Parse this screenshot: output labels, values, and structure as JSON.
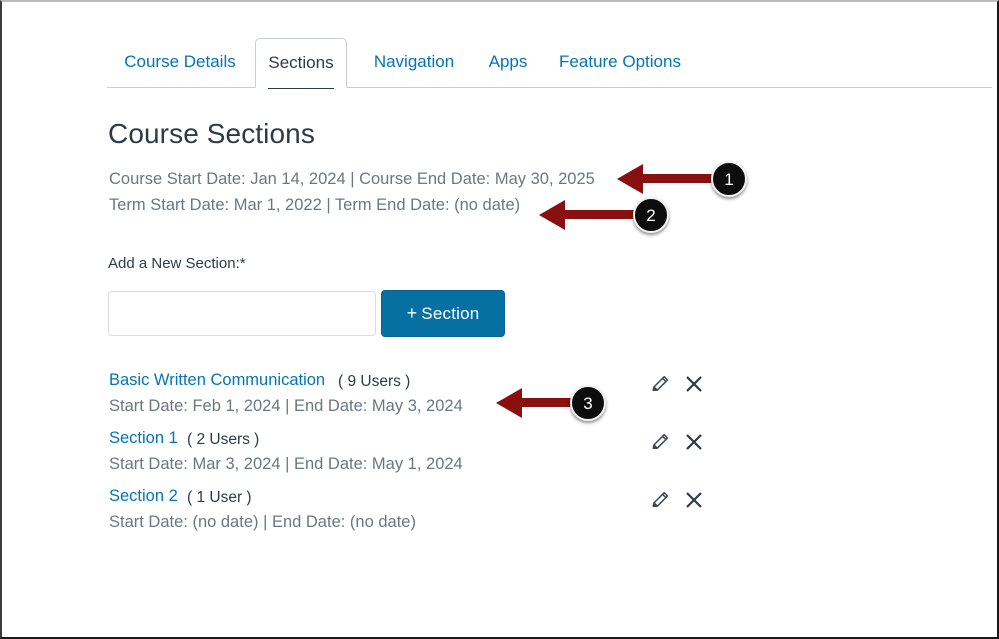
{
  "tabs": [
    {
      "label": "Course Details",
      "active": false
    },
    {
      "label": "Sections",
      "active": true
    },
    {
      "label": "Navigation",
      "active": false
    },
    {
      "label": "Apps",
      "active": false
    },
    {
      "label": "Feature Options",
      "active": false
    }
  ],
  "page": {
    "title": "Course Sections",
    "course_dates": "Course Start Date: Jan 14, 2024 | Course End Date: May 30, 2025",
    "term_dates": "Term Start Date: Mar 1, 2022 | Term End Date: (no date)"
  },
  "add_section": {
    "label": "Add a New Section:*",
    "input_value": "",
    "input_placeholder": "",
    "button_plus": "+",
    "button_label": "Section"
  },
  "sections": [
    {
      "name": "Basic Written Communication",
      "users": "( 9 Users )",
      "dates": "Start Date: Feb 1, 2024 | End Date: May 3, 2024",
      "edit_icon": "pencil-icon",
      "delete_icon": "close-x-icon"
    },
    {
      "name": "Section 1",
      "users": "( 2 Users )",
      "dates": "Start Date: Mar 3, 2024 | End Date: May 1, 2024",
      "edit_icon": "pencil-icon",
      "delete_icon": "close-x-icon"
    },
    {
      "name": "Section 2",
      "users": "( 1 User )",
      "dates": "Start Date: (no date) | End Date: (no date)",
      "edit_icon": "pencil-icon",
      "delete_icon": "close-x-icon"
    }
  ],
  "annotations": [
    {
      "number": "1"
    },
    {
      "number": "2"
    },
    {
      "number": "3"
    }
  ],
  "colors": {
    "link": "#0374b5",
    "button": "#0770a3",
    "muted_text": "#6b7780",
    "dark_text": "#2d3b45",
    "annotation_red": "#8a0f0f",
    "annotation_circle": "#0d0d0d"
  }
}
